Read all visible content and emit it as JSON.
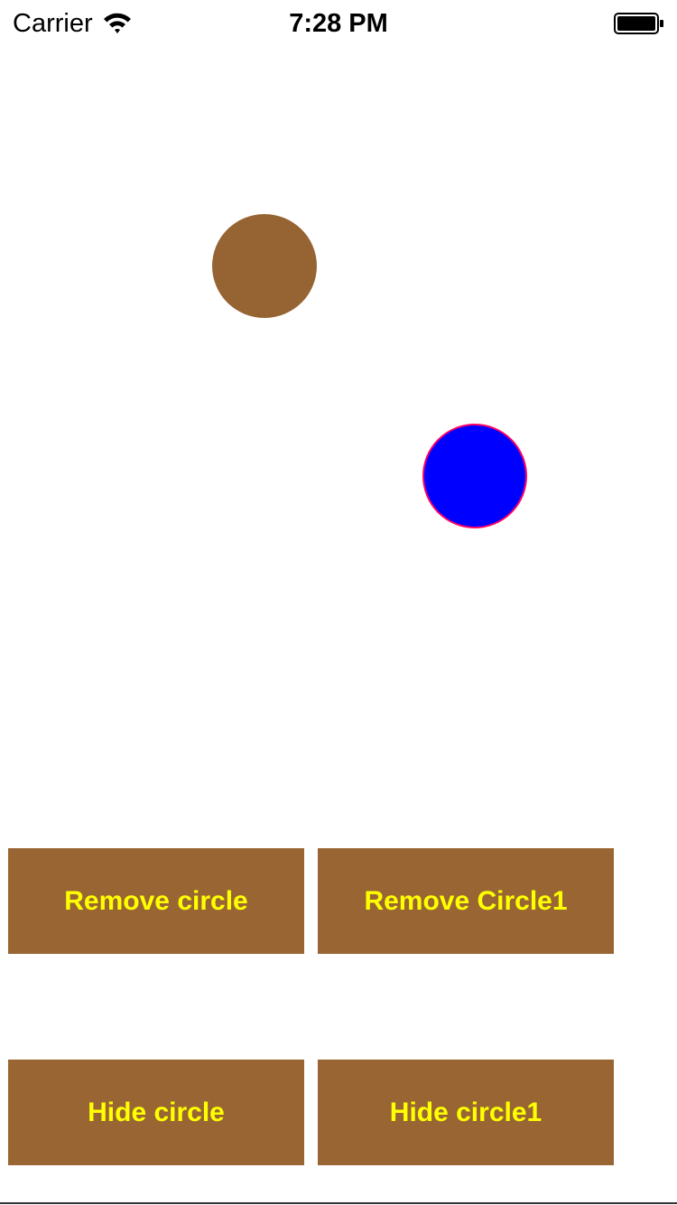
{
  "status_bar": {
    "carrier": "Carrier",
    "time": "7:28 PM",
    "wifi_icon": "wifi-icon",
    "battery_icon": "battery-icon"
  },
  "canvas": {
    "circles": [
      {
        "name": "circle",
        "color": "#966432"
      },
      {
        "name": "circle1",
        "color": "#0000ff",
        "border_color": "#ff0066"
      }
    ]
  },
  "buttons": {
    "remove_circle": "Remove circle",
    "remove_circle1": "Remove Circle1",
    "hide_circle": "Hide circle",
    "hide_circle1": "Hide circle1"
  },
  "colors": {
    "button_background": "#996633",
    "button_text": "#ffff00"
  }
}
